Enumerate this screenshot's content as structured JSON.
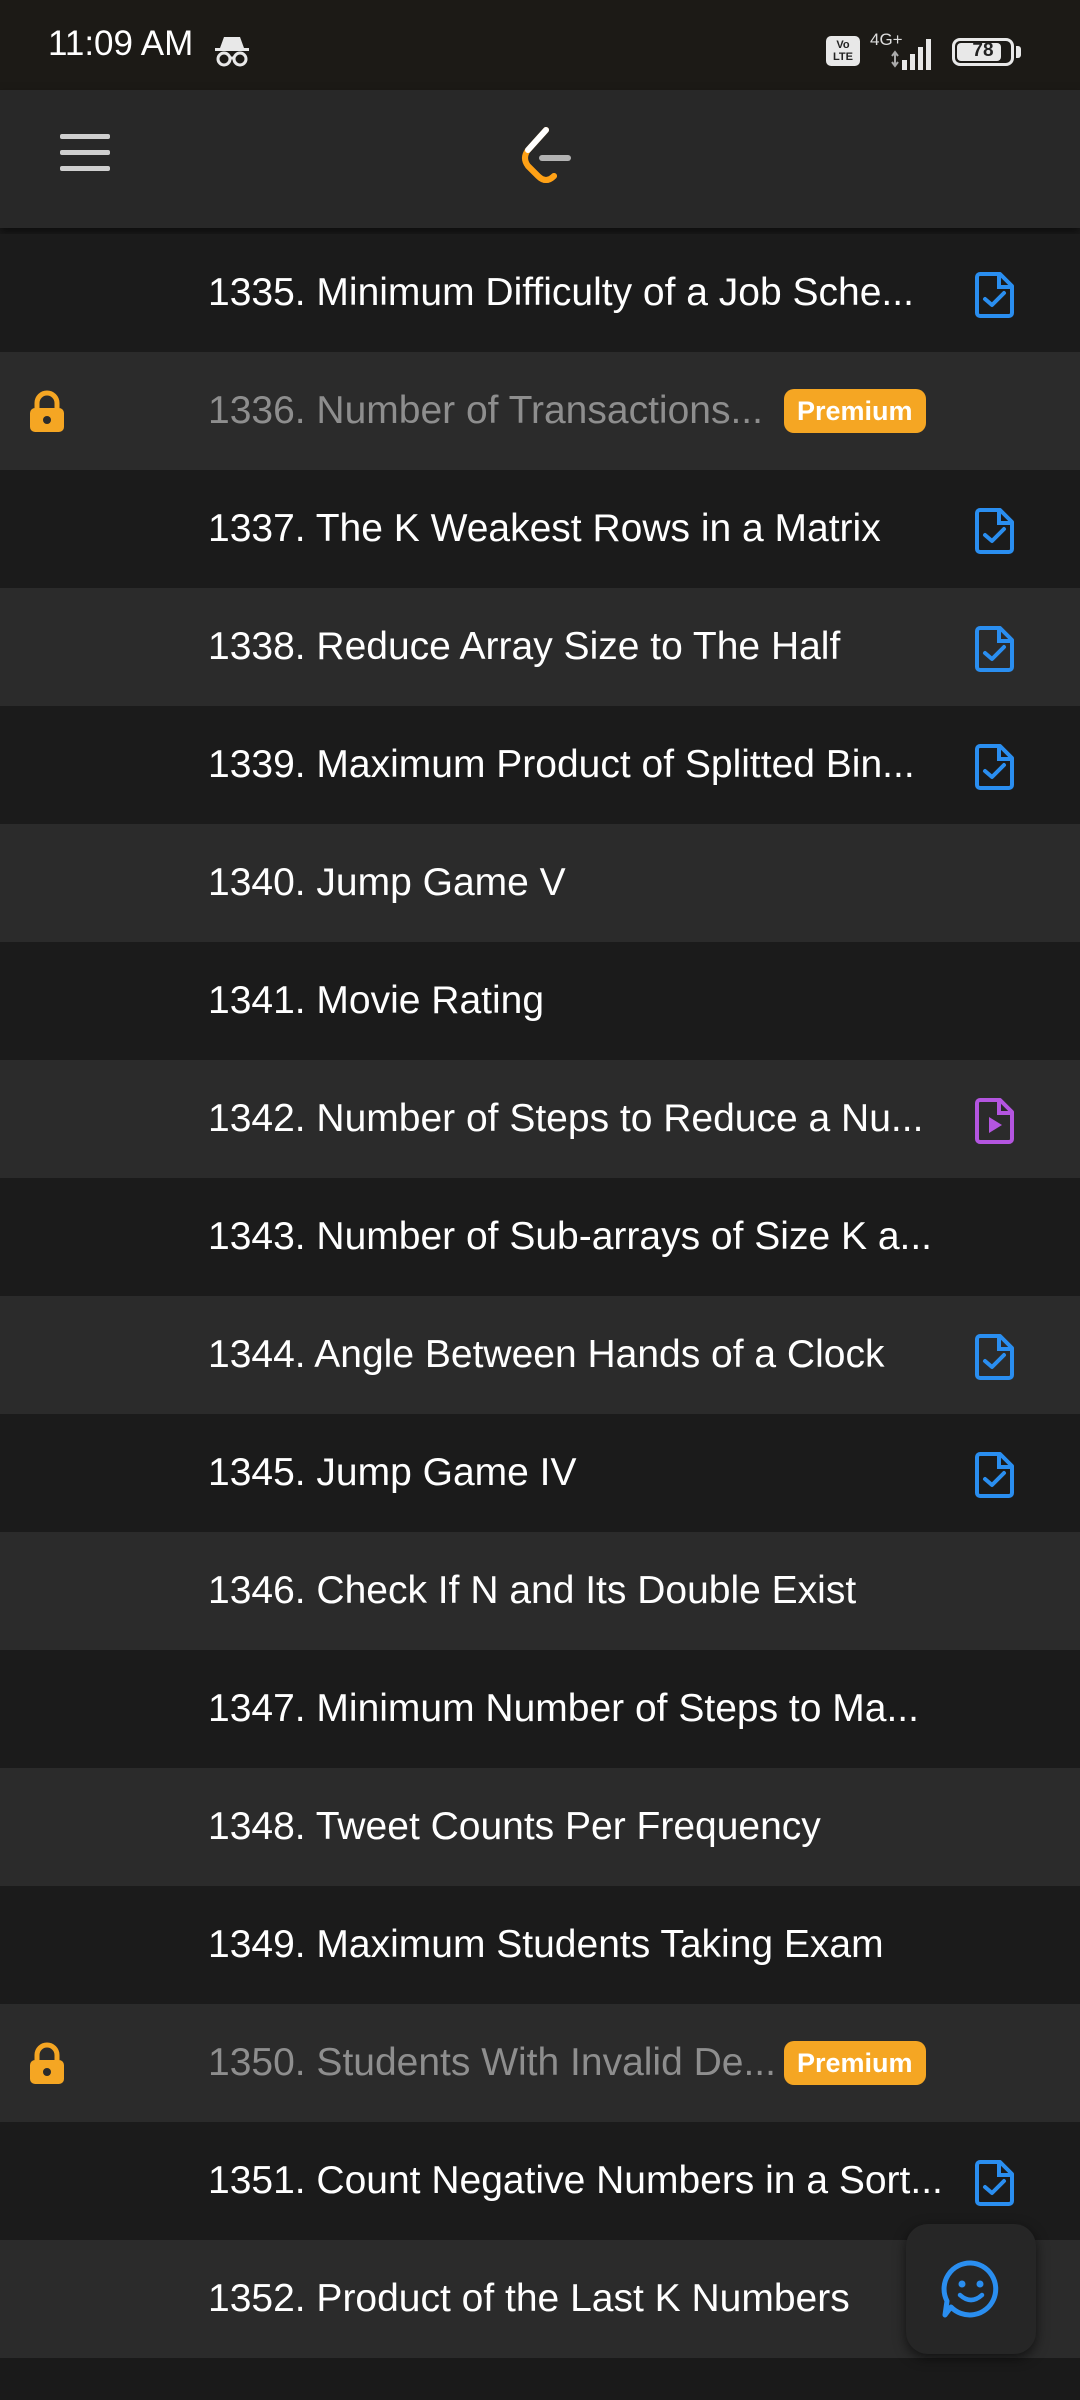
{
  "status_bar": {
    "time": "11:09 AM",
    "volte": "Vo LTE",
    "network": "4G+",
    "battery": "78",
    "battery_level": 0.78,
    "icons": [
      "incognito-icon",
      "signal-icon",
      "battery-icon"
    ]
  },
  "header": {
    "menu_icon": "hamburger-menu-icon",
    "logo_icon": "leetcode-logo-icon"
  },
  "colors": {
    "premium": "#f5a623",
    "solved_icon": "#2a8ef0",
    "video_icon": "#b455e0",
    "locked_text": "#8e8e8e"
  },
  "problems": [
    {
      "title": "1335. Minimum Difficulty of a Job Sche...",
      "status_icon": "solved-doc-icon"
    },
    {
      "title": "1336. Number of Transactions...",
      "locked": true,
      "badge": "Premium"
    },
    {
      "title": "1337. The K Weakest Rows in a Matrix",
      "status_icon": "solved-doc-icon"
    },
    {
      "title": "1338. Reduce Array Size to The Half",
      "status_icon": "solved-doc-icon"
    },
    {
      "title": "1339. Maximum Product of Splitted Bin...",
      "status_icon": "solved-doc-icon"
    },
    {
      "title": "1340. Jump Game V"
    },
    {
      "title": "1341. Movie Rating"
    },
    {
      "title": "1342. Number of Steps to Reduce a Nu...",
      "status_icon": "video-doc-icon"
    },
    {
      "title": "1343. Number of Sub-arrays of Size K a..."
    },
    {
      "title": "1344. Angle Between Hands of a Clock",
      "status_icon": "solved-doc-icon"
    },
    {
      "title": "1345. Jump Game IV",
      "status_icon": "solved-doc-icon"
    },
    {
      "title": "1346. Check If N and Its Double Exist"
    },
    {
      "title": "1347. Minimum Number of Steps to Ma..."
    },
    {
      "title": "1348. Tweet Counts Per Frequency"
    },
    {
      "title": "1349. Maximum Students Taking Exam"
    },
    {
      "title": "1350. Students With Invalid De...",
      "locked": true,
      "badge": "Premium"
    },
    {
      "title": "1351. Count Negative Numbers in a Sort...",
      "status_icon": "solved-doc-icon"
    },
    {
      "title": "1352. Product of the Last K Numbers"
    }
  ],
  "fab": {
    "icon": "feedback-smiley-icon"
  }
}
